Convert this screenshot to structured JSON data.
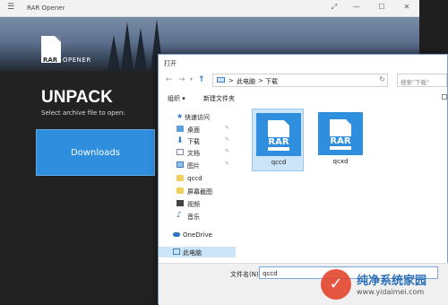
{
  "app": {
    "title": "RAR Opener",
    "logo_rar": "RAR",
    "logo_opener": "OPENER",
    "heading": "UNPACK",
    "subheading": "Select archive file to open:",
    "downloads_label": "Downloads"
  },
  "dialog": {
    "title": "打开",
    "address_segments": [
      "此电脑",
      "下载"
    ],
    "address_separator": ">",
    "search_placeholder": "搜索\"下载\"",
    "toolbar": {
      "organize": "组织 ▾",
      "new_folder": "新建文件夹"
    },
    "nav_items": [
      {
        "label": "快速访问"
      },
      {
        "label": "桌面"
      },
      {
        "label": "下载"
      },
      {
        "label": "文档"
      },
      {
        "label": "图片"
      },
      {
        "label": "qccd"
      },
      {
        "label": "屏幕截图"
      },
      {
        "label": "视频"
      },
      {
        "label": "音乐"
      },
      {
        "label": "OneDrive"
      },
      {
        "label": "此电脑"
      }
    ],
    "files": [
      {
        "name": "qccd",
        "icon_text": "RAR"
      },
      {
        "name": "qcxd",
        "icon_text": "RAR"
      }
    ],
    "filename_label": "文件名(N):",
    "filename_value": "qccd"
  },
  "watermark": {
    "text": "纯净系统家园",
    "url": "www.yidaimei.com"
  },
  "colors": {
    "accent": "#2f8fde",
    "selection": "#cce4f7"
  }
}
